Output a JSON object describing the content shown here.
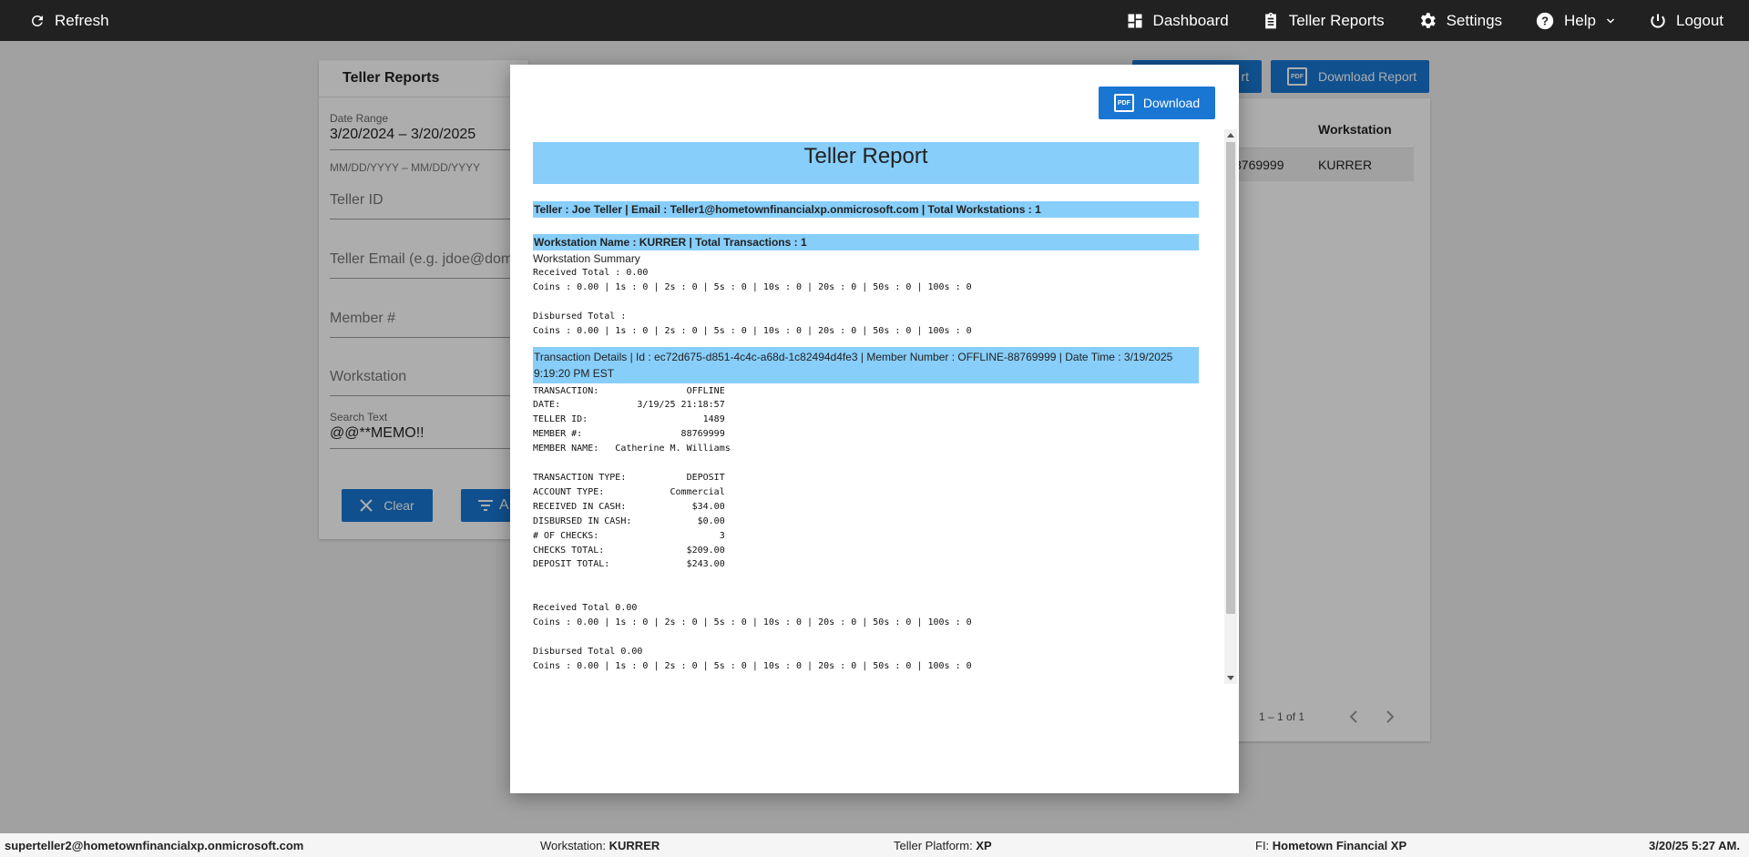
{
  "topbar": {
    "refresh_label": "Refresh",
    "nav": [
      {
        "label": "Dashboard",
        "icon": "dashboard-icon"
      },
      {
        "label": "Teller Reports",
        "icon": "clipboard-icon"
      },
      {
        "label": "Settings",
        "icon": "gear-icon"
      },
      {
        "label": "Help",
        "icon": "help-icon"
      },
      {
        "label": "Logout",
        "icon": "power-icon"
      }
    ]
  },
  "page": {
    "card_title": "Teller Reports",
    "date_range_label": "Date Range",
    "date_range_value": "3/20/2024 – 3/20/2025",
    "date_range_hint": "MM/DD/YYYY – MM/DD/YYYY",
    "teller_id_placeholder": "Teller ID",
    "teller_email_placeholder": "Teller Email (e.g. jdoe@dom",
    "member_placeholder": "Member #",
    "workstation_placeholder": "Workstation",
    "search_label": "Search Text",
    "search_value": "@@**MEMO!!",
    "clear_label": "Clear",
    "apply_fragment": "A",
    "export_fragment": "rt",
    "download_report_label": "Download Report",
    "table_header_workstation": "Workstation",
    "table_member_fragment": "8769999",
    "table_workstation_value": "KURRER",
    "pagination": "1 – 1 of 1"
  },
  "modal": {
    "download_label": "Download",
    "report": {
      "title": "Teller Report",
      "teller_line": "Teller : Joe Teller | Email : Teller1@hometownfinancialxp.onmicrosoft.com | Total Workstations : 1",
      "workstation_line": "Workstation Name : KURRER | Total Transactions : 1",
      "summary_heading": "Workstation Summary",
      "summary_block": "Received Total : 0.00\nCoins : 0.00 | 1s : 0 | 2s : 0 | 5s : 0 | 10s : 0 | 20s : 0 | 50s : 0 | 100s : 0\n\nDisbursed Total :\nCoins : 0.00 | 1s : 0 | 2s : 0 | 5s : 0 | 10s : 0 | 20s : 0 | 50s : 0 | 100s : 0",
      "transaction_header": "Transaction Details | Id : ec72d675-d851-4c4c-a68d-1c82494d4fe3 | Member Number : OFFLINE-88769999 | Date Time : 3/19/2025 9:19:20 PM EST",
      "receipt_block": "TRANSACTION:                OFFLINE\nDATE:              3/19/25 21:18:57\nTELLER ID:                     1489\nMEMBER #:                  88769999\nMEMBER NAME:   Catherine M. Williams\n\nTRANSACTION TYPE:           DEPOSIT\nACCOUNT TYPE:            Commercial\nRECEIVED IN CASH:            $34.00\nDISBURSED IN CASH:            $0.00\n# OF CHECKS:                      3\nCHECKS TOTAL:               $209.00\nDEPOSIT TOTAL:              $243.00\n\n\nReceived Total 0.00\nCoins : 0.00 | 1s : 0 | 2s : 0 | 5s : 0 | 10s : 0 | 20s : 0 | 50s : 0 | 100s : 0\n\nDisbursed Total 0.00\nCoins : 0.00 | 1s : 0 | 2s : 0 | 5s : 0 | 10s : 0 | 20s : 0 | 50s : 0 | 100s : 0"
    }
  },
  "footer": {
    "user_email": "superteller2@hometownfinancialxp.onmicrosoft.com",
    "workstation_label": "Workstation:",
    "workstation_value": "KURRER",
    "platform_label": "Teller Platform:",
    "platform_value": "XP",
    "fi_label": "FI:",
    "fi_value": "Hometown Financial XP",
    "datetime": "3/20/25 5:27 AM."
  },
  "colors": {
    "topbar_bg": "#212121",
    "primary_button": "#1976d2",
    "report_band": "#87cefa"
  }
}
